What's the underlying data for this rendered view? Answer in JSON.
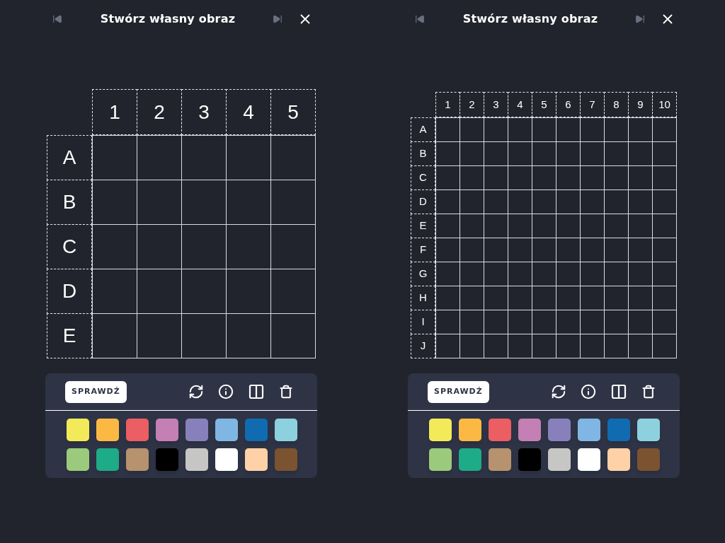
{
  "panels": [
    {
      "title": "Stwórz własny obraz",
      "columns": [
        "1",
        "2",
        "3",
        "4",
        "5"
      ],
      "rows": [
        "A",
        "B",
        "C",
        "D",
        "E"
      ],
      "check_button": "SPRAWDŹ",
      "colors": [
        {
          "color": "#f3ea5a"
        },
        {
          "color": "#fbb944"
        },
        {
          "color": "#eb5e63"
        },
        {
          "color": "#c47fb4"
        },
        {
          "color": "#8880bb"
        },
        {
          "color": "#80b6e4"
        },
        {
          "color": "#106bb1"
        },
        {
          "color": "#8dd1df"
        },
        {
          "color": "#9cca7c"
        },
        {
          "color": "#1eab87"
        },
        {
          "color": "#b6926f"
        },
        {
          "color": "#000000"
        },
        {
          "color": "#c6c6c5"
        },
        {
          "color": "#ffffff"
        },
        {
          "color": "#fed1a6"
        },
        {
          "color": "#7b5331"
        }
      ]
    },
    {
      "title": "Stwórz własny obraz",
      "columns": [
        "1",
        "2",
        "3",
        "4",
        "5",
        "6",
        "7",
        "8",
        "9",
        "10"
      ],
      "rows": [
        "A",
        "B",
        "C",
        "D",
        "E",
        "F",
        "G",
        "H",
        "I",
        "J"
      ],
      "check_button": "SPRAWDŹ",
      "colors": [
        {
          "color": "#f3ea5a"
        },
        {
          "color": "#fbb944"
        },
        {
          "color": "#eb5e63"
        },
        {
          "color": "#c47fb4"
        },
        {
          "color": "#8880bb"
        },
        {
          "color": "#80b6e4"
        },
        {
          "color": "#106bb1"
        },
        {
          "color": "#8dd1df"
        },
        {
          "color": "#9cca7c"
        },
        {
          "color": "#1eab87"
        },
        {
          "color": "#b6926f"
        },
        {
          "color": "#000000"
        },
        {
          "color": "#c6c6c5"
        },
        {
          "color": "#ffffff"
        },
        {
          "color": "#fed1a6"
        },
        {
          "color": "#7b5331"
        }
      ]
    }
  ]
}
